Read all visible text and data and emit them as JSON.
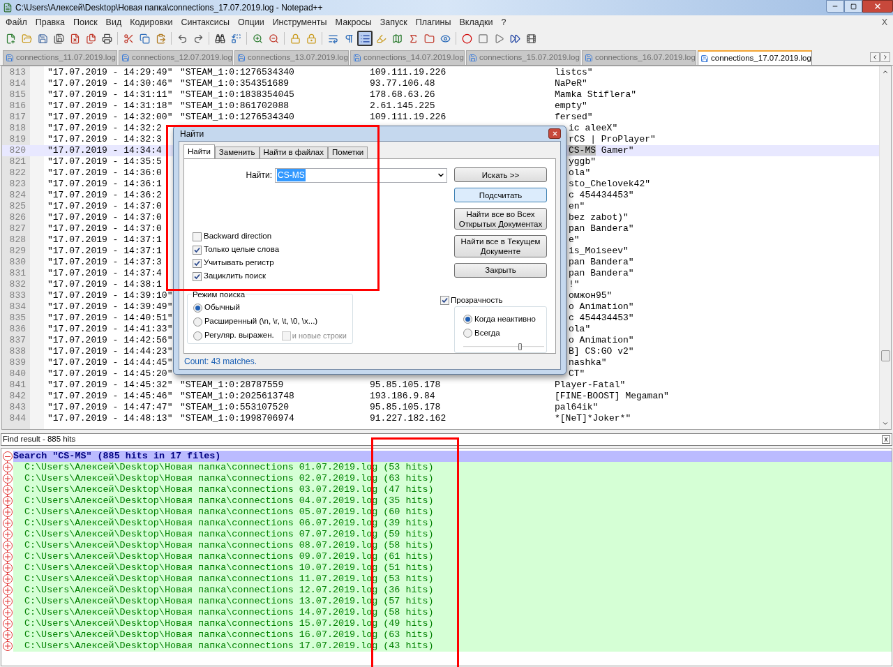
{
  "window": {
    "title": "C:\\Users\\Алексей\\Desktop\\Новая папка\\connections_17.07.2019.log - Notepad++"
  },
  "menu": [
    "Файл",
    "Правка",
    "Поиск",
    "Вид",
    "Кодировки",
    "Синтаксисы",
    "Опции",
    "Инструменты",
    "Макросы",
    "Запуск",
    "Плагины",
    "Вкладки",
    "?"
  ],
  "menu_close": "X",
  "toolbar": [
    {
      "kind": "new",
      "pressed": false
    },
    {
      "kind": "open",
      "pressed": false
    },
    {
      "kind": "save",
      "pressed": false
    },
    {
      "kind": "save-all",
      "pressed": false
    },
    {
      "kind": "close",
      "pressed": false
    },
    {
      "kind": "close-all",
      "pressed": false
    },
    {
      "kind": "print",
      "pressed": false
    },
    {
      "kind": "separator"
    },
    {
      "kind": "cut",
      "pressed": false
    },
    {
      "kind": "copy",
      "pressed": false
    },
    {
      "kind": "paste",
      "pressed": false
    },
    {
      "kind": "separator"
    },
    {
      "kind": "undo",
      "pressed": false
    },
    {
      "kind": "redo",
      "pressed": false
    },
    {
      "kind": "separator"
    },
    {
      "kind": "find",
      "pressed": false
    },
    {
      "kind": "replace",
      "pressed": false
    },
    {
      "kind": "separator"
    },
    {
      "kind": "zoom-in",
      "pressed": false
    },
    {
      "kind": "zoom-out",
      "pressed": false
    },
    {
      "kind": "separator"
    },
    {
      "kind": "sync-v",
      "pressed": false
    },
    {
      "kind": "sync-h",
      "pressed": false
    },
    {
      "kind": "separator"
    },
    {
      "kind": "wrap",
      "pressed": false
    },
    {
      "kind": "all-chars",
      "pressed": false
    },
    {
      "kind": "indent",
      "pressed": true
    },
    {
      "kind": "udl",
      "pressed": false
    },
    {
      "kind": "doc-map",
      "pressed": false
    },
    {
      "kind": "function",
      "pressed": false
    },
    {
      "kind": "folder",
      "pressed": false
    },
    {
      "kind": "monitor",
      "pressed": false
    },
    {
      "kind": "separator"
    },
    {
      "kind": "record",
      "pressed": false
    },
    {
      "kind": "stop",
      "pressed": false
    },
    {
      "kind": "play",
      "pressed": false
    },
    {
      "kind": "play-multi",
      "pressed": false
    },
    {
      "kind": "save-macro",
      "pressed": false
    }
  ],
  "tabs": [
    {
      "label": "connections_11.07.2019.log",
      "selected": false
    },
    {
      "label": "connections_12.07.2019.log",
      "selected": false
    },
    {
      "label": "connections_13.07.2019.log",
      "selected": false
    },
    {
      "label": "connections_14.07.2019.log",
      "selected": false
    },
    {
      "label": "connections_15.07.2019.log",
      "selected": false
    },
    {
      "label": "connections_16.07.2019.log",
      "selected": false
    },
    {
      "label": "connections_17.07.2019.log",
      "selected": true
    }
  ],
  "editor": {
    "lines": [
      {
        "number": "813",
        "date_time": "\"17.07.2019 - 14:29:49\"",
        "steam": "\"STEAM_1:0:1276534340",
        "ip": "109.111.19.226",
        "name": "listcs\"",
        "current": false
      },
      {
        "number": "814",
        "date_time": "\"17.07.2019 - 14:30:46\"",
        "steam": "\"STEAM_1:0:354351689",
        "ip": "93.77.106.48",
        "name": "NaPeR\"",
        "current": false
      },
      {
        "number": "815",
        "date_time": "\"17.07.2019 - 14:31:11\"",
        "steam": "\"STEAM_1:0:1838354045",
        "ip": "178.68.63.26",
        "name": "Mamka Stiflera\"",
        "current": false
      },
      {
        "number": "816",
        "date_time": "\"17.07.2019 - 14:31:18\"",
        "steam": "\"STEAM_1:0:861702088",
        "ip": "2.61.145.225",
        "name": "empty\"",
        "current": false
      },
      {
        "number": "817",
        "date_time": "\"17.07.2019 - 14:32:00\"",
        "steam": "\"STEAM_1:0:1276534340",
        "ip": "109.111.19.226",
        "name": "fersed\"",
        "current": false
      },
      {
        "number": "818",
        "date_time": "\"17.07.2019 - 14:32:2",
        "name": "ic aleeX\"",
        "current": false
      },
      {
        "number": "819",
        "date_time": "\"17.07.2019 - 14:32:3",
        "name": "rCS | ProPlayer\"",
        "current": false
      },
      {
        "number": "820",
        "date_time": "\"17.07.2019 - 14:34:4",
        "name_parts": [
          {
            "text": "CS-MS",
            "match": true
          },
          {
            "text": " Gamer\"",
            "match": false
          }
        ],
        "current": true
      },
      {
        "number": "821",
        "date_time": "\"17.07.2019 - 14:35:5",
        "name": "yggb\"",
        "current": false
      },
      {
        "number": "822",
        "date_time": "\"17.07.2019 - 14:36:0",
        "name": "ola\"",
        "current": false
      },
      {
        "number": "823",
        "date_time": "\"17.07.2019 - 14:36:1",
        "name": "sto_Chelovek42\"",
        "current": false
      },
      {
        "number": "824",
        "date_time": "\"17.07.2019 - 14:36:2",
        "name": "c 454434453\"",
        "current": false
      },
      {
        "number": "825",
        "date_time": "\"17.07.2019 - 14:37:0",
        "name": "en\"",
        "current": false
      },
      {
        "number": "826",
        "date_time": "\"17.07.2019 - 14:37:0",
        "name": "bez zabot)\"",
        "current": false
      },
      {
        "number": "827",
        "date_time": "\"17.07.2019 - 14:37:0",
        "name": "pan Bandera\"",
        "current": false
      },
      {
        "number": "828",
        "date_time": "\"17.07.2019 - 14:37:1",
        "name": "e\"",
        "current": false
      },
      {
        "number": "829",
        "date_time": "\"17.07.2019 - 14:37:1",
        "name": "is_Moiseev\"",
        "current": false
      },
      {
        "number": "830",
        "date_time": "\"17.07.2019 - 14:37:3",
        "name": "pan Bandera\"",
        "current": false
      },
      {
        "number": "831",
        "date_time": "\"17.07.2019 - 14:37:4",
        "name": "pan Bandera\"",
        "current": false
      },
      {
        "number": "832",
        "date_time": "\"17.07.2019 - 14:38:1",
        "name": "!\"",
        "current": false
      },
      {
        "number": "833",
        "date_time": "\"17.07.2019 - 14:39:10\"",
        "name": "омжон95\"",
        "current": false
      },
      {
        "number": "834",
        "date_time": "\"17.07.2019 - 14:39:49\"",
        "name": "o Animation\"",
        "current": false
      },
      {
        "number": "835",
        "date_time": "\"17.07.2019 - 14:40:51\"",
        "name": "c 454434453\"",
        "current": false
      },
      {
        "number": "836",
        "date_time": "\"17.07.2019 - 14:41:33\"",
        "name": "ola\"",
        "current": false
      },
      {
        "number": "837",
        "date_time": "\"17.07.2019 - 14:42:56\"",
        "name": "o Animation\"",
        "current": false
      },
      {
        "number": "838",
        "date_time": "\"17.07.2019 - 14:44:23\"",
        "name": "B] CS:GO v2\"",
        "current": false
      },
      {
        "number": "839",
        "date_time": "\"17.07.2019 - 14:44:45\"",
        "name": "nashka\"",
        "current": false
      },
      {
        "number": "840",
        "date_time": "\"17.07.2019 - 14:45:20\"",
        "name": "CT\"",
        "current": false
      },
      {
        "number": "841",
        "date_time": "\"17.07.2019 - 14:45:32\"",
        "steam": "\"STEAM_1:0:28787559",
        "ip": "95.85.105.178",
        "name": "Player-Fatal\"",
        "current": false
      },
      {
        "number": "842",
        "date_time": "\"17.07.2019 - 14:45:46\"",
        "steam": "\"STEAM_1:0:2025613748",
        "ip": "193.186.9.84",
        "name": "[FINE-BOOST] Megaman\"",
        "current": false
      },
      {
        "number": "843",
        "date_time": "\"17.07.2019 - 14:47:47\"",
        "steam": "\"STEAM_1:0:553107520",
        "ip": "95.85.105.178",
        "name": "pal64ik\"",
        "current": false
      },
      {
        "number": "844",
        "date_time": "\"17.07.2019 - 14:48:13\"",
        "steam": "\"STEAM_1:0:1998706974",
        "ip": "91.227.182.162",
        "name": "*[NeT]*Joker*\"",
        "current": false
      }
    ]
  },
  "dialog": {
    "title": "Найти",
    "tabs": [
      {
        "label": "Найти",
        "selected": true
      },
      {
        "label": "Заменить",
        "selected": false
      },
      {
        "label": "Найти в файлах",
        "selected": false
      },
      {
        "label": "Пометки",
        "selected": false
      }
    ],
    "find_label": "Найти:",
    "find_value": "CS-MS",
    "buttons": [
      {
        "label": "Искать >>",
        "default": false
      },
      {
        "label": "Подсчитать",
        "default": true
      },
      {
        "label": "Найти все во Всех Открытых Документах",
        "default": false
      },
      {
        "label": "Найти все в Текущем Документе",
        "default": false
      },
      {
        "label": "Закрыть",
        "default": false
      }
    ],
    "options": [
      {
        "label": "Backward direction",
        "checked": false
      },
      {
        "label": "Только целые слова",
        "checked": true
      },
      {
        "label": "Учитывать регистр",
        "checked": true
      },
      {
        "label": "Зациклить поиск",
        "checked": true
      }
    ],
    "search_mode": {
      "title": "Режим поиска",
      "modes": [
        {
          "label": "Обычный",
          "selected": true
        },
        {
          "label": "Расширенный (\\n, \\r, \\t, \\0, \\x...)",
          "selected": false
        },
        {
          "label": "Регуляр. выражен.",
          "selected": false
        }
      ],
      "newlines": {
        "label": "и новые строки",
        "checked": false,
        "disabled": true
      }
    },
    "transparency": {
      "label": "Прозрачность",
      "checked": true,
      "modes": [
        {
          "label": "Когда неактивно",
          "selected": true
        },
        {
          "label": "Всегда",
          "selected": false
        }
      ],
      "level": 0.7
    },
    "status": "Count: 43 matches."
  },
  "find_result": {
    "title": "Find result - 885 hits",
    "close": "x",
    "search": "Search \"CS-MS\" (885 hits in 17 files)",
    "files": [
      {
        "path": "C:\\Users\\Алексей\\Desktop\\Новая папка\\connections 01.07.2019.log",
        "hits": "(53 hits)"
      },
      {
        "path": "C:\\Users\\Алексей\\Desktop\\Новая папка\\connections 02.07.2019.log",
        "hits": "(63 hits)"
      },
      {
        "path": "C:\\Users\\Алексей\\Desktop\\Новая папка\\connections 03.07.2019.log",
        "hits": "(47 hits)"
      },
      {
        "path": "C:\\Users\\Алексей\\Desktop\\Новая папка\\connections 04.07.2019.log",
        "hits": "(35 hits)"
      },
      {
        "path": "C:\\Users\\Алексей\\Desktop\\Новая папка\\connections 05.07.2019.log",
        "hits": "(60 hits)"
      },
      {
        "path": "C:\\Users\\Алексей\\Desktop\\Новая папка\\connections 06.07.2019.log",
        "hits": "(39 hits)"
      },
      {
        "path": "C:\\Users\\Алексей\\Desktop\\Новая папка\\connections 07.07.2019.log",
        "hits": "(59 hits)"
      },
      {
        "path": "C:\\Users\\Алексей\\Desktop\\Новая папка\\connections 08.07.2019.log",
        "hits": "(58 hits)"
      },
      {
        "path": "C:\\Users\\Алексей\\Desktop\\Новая папка\\connections 09.07.2019.log",
        "hits": "(61 hits)"
      },
      {
        "path": "C:\\Users\\Алексей\\Desktop\\Новая папка\\connections 10.07.2019.log",
        "hits": "(51 hits)"
      },
      {
        "path": "C:\\Users\\Алексей\\Desktop\\Новая папка\\connections 11.07.2019.log",
        "hits": "(53 hits)"
      },
      {
        "path": "C:\\Users\\Алексей\\Desktop\\Новая папка\\connections 12.07.2019.log",
        "hits": "(36 hits)"
      },
      {
        "path": "C:\\Users\\Алексей\\Desktop\\Новая папка\\connections 13.07.2019.log",
        "hits": "(57 hits)"
      },
      {
        "path": "C:\\Users\\Алексей\\Desktop\\Новая папка\\connections 14.07.2019.log",
        "hits": "(58 hits)"
      },
      {
        "path": "C:\\Users\\Алексей\\Desktop\\Новая папка\\connections 15.07.2019.log",
        "hits": "(49 hits)"
      },
      {
        "path": "C:\\Users\\Алексей\\Desktop\\Новая папка\\connections 16.07.2019.log",
        "hits": "(63 hits)"
      },
      {
        "path": "C:\\Users\\Алексей\\Desktop\\Новая папка\\connections 17.07.2019.log",
        "hits": "(43 hits)"
      }
    ]
  }
}
